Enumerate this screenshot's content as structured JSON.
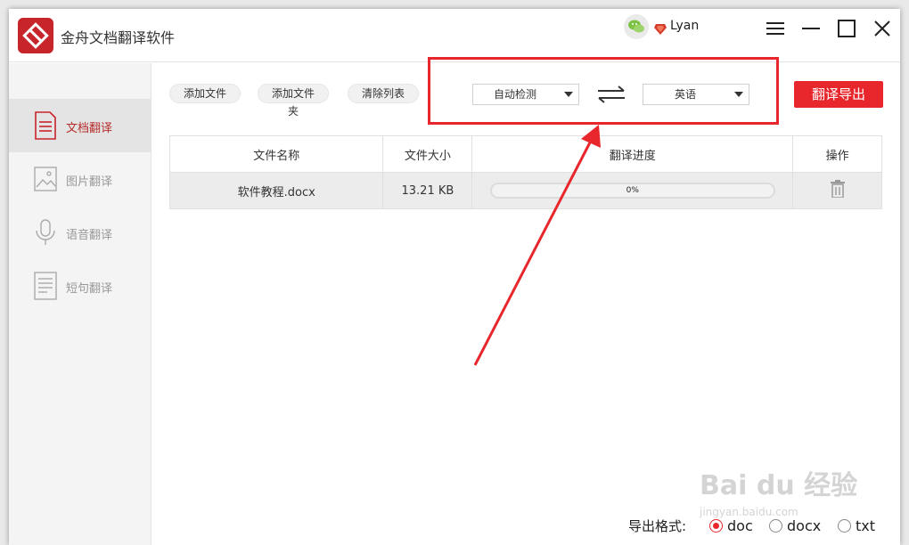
{
  "app": {
    "title": "金舟文档翻译软件"
  },
  "user": {
    "name": "Lyan"
  },
  "sidebar": {
    "items": [
      {
        "label": "文档翻译",
        "active": true,
        "icon": "document-icon"
      },
      {
        "label": "图片翻译",
        "active": false,
        "icon": "image-icon"
      },
      {
        "label": "语音翻译",
        "active": false,
        "icon": "microphone-icon"
      },
      {
        "label": "短句翻译",
        "active": false,
        "icon": "text-lines-icon"
      }
    ]
  },
  "toolbar": {
    "add_file": "添加文件",
    "add_folder": "添加文件夹",
    "clear_list": "清除列表",
    "source_lang": "自动检测",
    "target_lang": "英语",
    "export_button": "翻译导出"
  },
  "table": {
    "headers": [
      "文件名称",
      "文件大小",
      "翻译进度",
      "操作"
    ],
    "rows": [
      {
        "name": "软件教程.docx",
        "size": "13.21 KB",
        "progress_text": "0%",
        "progress": 0
      }
    ]
  },
  "footer": {
    "export_format_label": "导出格式:",
    "formats": [
      {
        "label": "doc",
        "checked": true
      },
      {
        "label": "docx",
        "checked": false
      },
      {
        "label": "txt",
        "checked": false
      }
    ]
  },
  "watermark": {
    "line1": "Bai du 经验",
    "line2": "jingyan.baidu.com"
  },
  "colors": {
    "accent": "#e8272c",
    "logo": "#c8242b",
    "active_nav_text": "#b62a2a"
  }
}
